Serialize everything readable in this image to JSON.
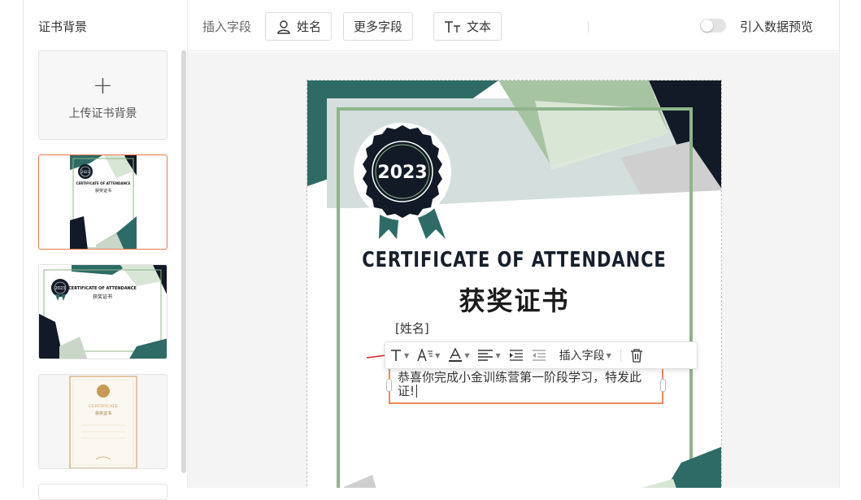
{
  "sidebar": {
    "title": "证书背景",
    "upload_label": "上传证书背景",
    "thumb1": {
      "year": "2023",
      "title": "CERTIFICATE OF ATTENDANCE",
      "sub": "获奖证书"
    },
    "thumb2": {
      "year": "2023",
      "title": "CERTIFICATE OF ATTENDANCE",
      "sub": "获奖证书"
    },
    "thumb3": {
      "title": "CERTIFICATE",
      "sub": "获奖证书"
    }
  },
  "toolbar": {
    "insert_field_label": "插入字段",
    "name_button": "姓名",
    "more_fields_button": "更多字段",
    "text_button": "文本",
    "data_preview_label": "引入数据预览",
    "data_preview_on": false
  },
  "certificate": {
    "year": "2023",
    "title": "CERTIFICATE OF ATTENDANCE",
    "subtitle": "获奖证书",
    "name_field": "[姓名]",
    "body_text": "恭喜你完成小金训练营第一阶段学习，特发此证!"
  },
  "format_bar": {
    "insert_field": "插入字段"
  },
  "colors": {
    "accent": "#f08a54",
    "teal": "#2e6b66",
    "navy": "#111a26",
    "sage": "#8fb58a"
  }
}
